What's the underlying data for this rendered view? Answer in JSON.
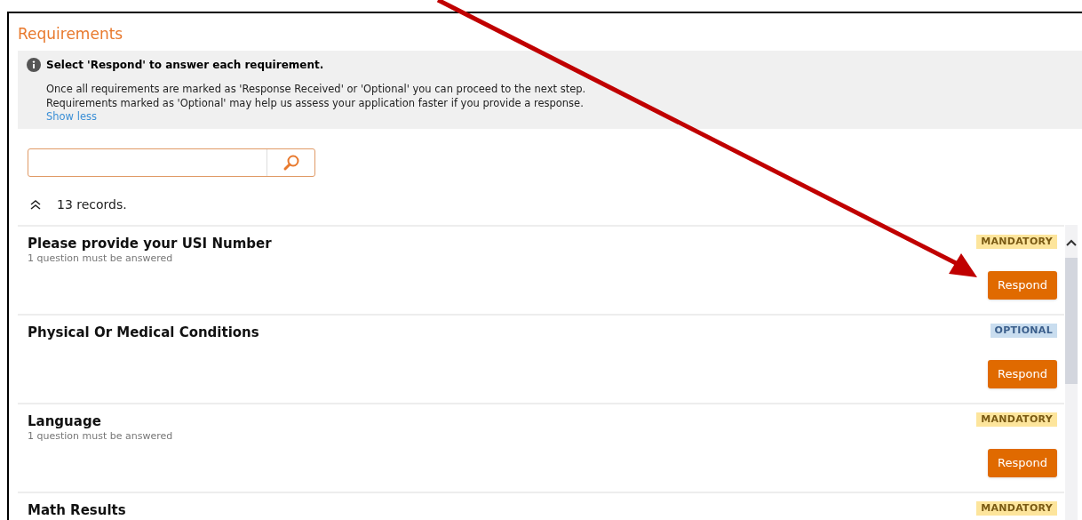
{
  "panel": {
    "title": "Requirements"
  },
  "info": {
    "heading": "Select 'Respond' to answer each requirement.",
    "lines": [
      "Once all requirements are marked as 'Response Received' or 'Optional' you can proceed to the next step.",
      "Requirements marked as 'Optional' may help us assess your application faster if you provide a response."
    ],
    "toggle": "Show less"
  },
  "records": {
    "count": "13 records.",
    "expanded": true
  },
  "requirements": [
    {
      "title": "Please provide your USI Number",
      "subtitle": "1 question must be answered",
      "badge": "MANDATORY",
      "kind": "mandatory",
      "action": "Respond"
    },
    {
      "title": "Physical Or Medical Conditions",
      "badge": "OPTIONAL",
      "kind": "optional",
      "action": "Respond"
    },
    {
      "title": "Language",
      "subtitle": "1 question must be answered",
      "badge": "MANDATORY",
      "kind": "mandatory",
      "action": "Respond"
    },
    {
      "title": "Math Results",
      "badge": "MANDATORY",
      "kind": "mandatory"
    }
  ]
}
